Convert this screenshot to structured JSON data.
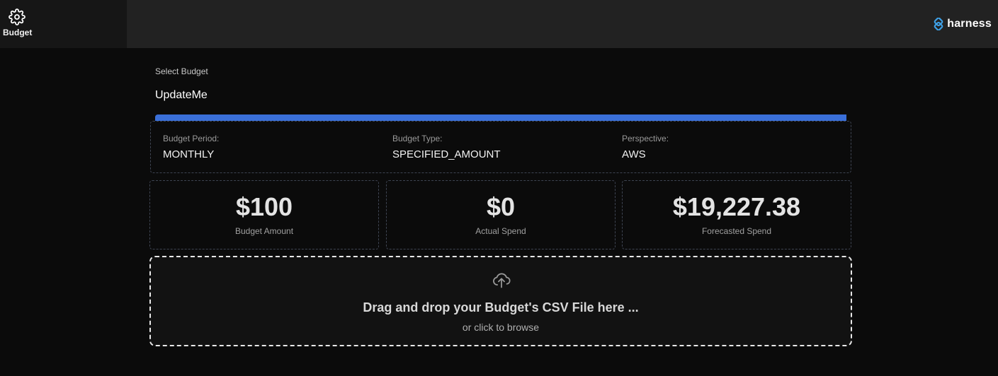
{
  "nav": {
    "active_tab": {
      "label": "Budget",
      "icon": "gear-icon"
    }
  },
  "brand": {
    "name": "harness",
    "logo_color": "#3ea0e6"
  },
  "budget_select": {
    "label": "Select Budget",
    "value": "UpdateMe"
  },
  "progress": {
    "percent": 100
  },
  "details": {
    "period": {
      "label": "Budget Period:",
      "value": "MONTHLY"
    },
    "type": {
      "label": "Budget Type:",
      "value": "SPECIFIED_AMOUNT"
    },
    "perspective": {
      "label": "Perspective:",
      "value": "AWS"
    }
  },
  "stats": {
    "budget_amount": {
      "value": "$100",
      "label": "Budget Amount"
    },
    "actual_spend": {
      "value": "$0",
      "label": "Actual Spend"
    },
    "forecasted_spend": {
      "value": "$19,227.38",
      "label": "Forecasted Spend"
    }
  },
  "upload": {
    "icon": "cloud-upload-icon",
    "title": "Drag and drop your Budget's CSV File here ...",
    "subtitle": "or click to browse"
  }
}
